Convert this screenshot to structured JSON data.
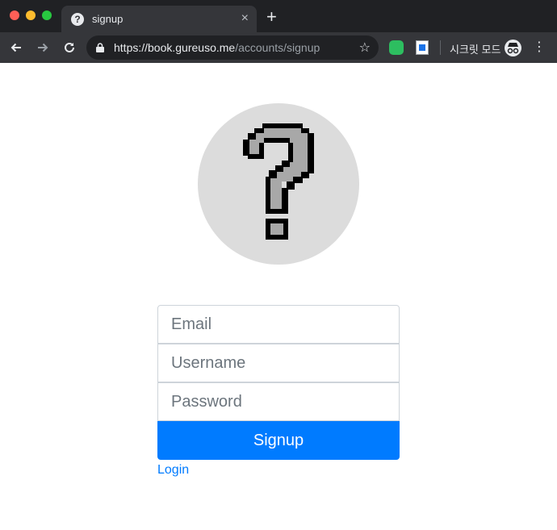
{
  "browser": {
    "tab": {
      "title": "signup",
      "close_symbol": "×",
      "favicon_symbol": "?"
    },
    "new_tab_symbol": "+",
    "url": {
      "host": "https://book.gureuso.me",
      "path": "/accounts/signup"
    },
    "incognito_label": "시크릿 모드",
    "icons": {
      "back": "arrow-left-icon",
      "forward": "arrow-right-icon",
      "reload": "reload-icon",
      "lock": "lock-icon",
      "bookmark": "star-icon",
      "extension1": "evernote-icon",
      "extension2": "extension-icon",
      "incognito": "incognito-icon",
      "menu": "more-vertical-icon"
    }
  },
  "page": {
    "avatar_icon": "question-mark-pixel-icon",
    "form": {
      "email_placeholder": "Email",
      "username_placeholder": "Username",
      "password_placeholder": "Password",
      "signup_label": "Signup",
      "login_label": "Login"
    },
    "colors": {
      "primary": "#007bff",
      "avatar_bg": "#dcdcdc",
      "glyph_fill": "#a8a8a8",
      "glyph_outline": "#000000"
    }
  }
}
